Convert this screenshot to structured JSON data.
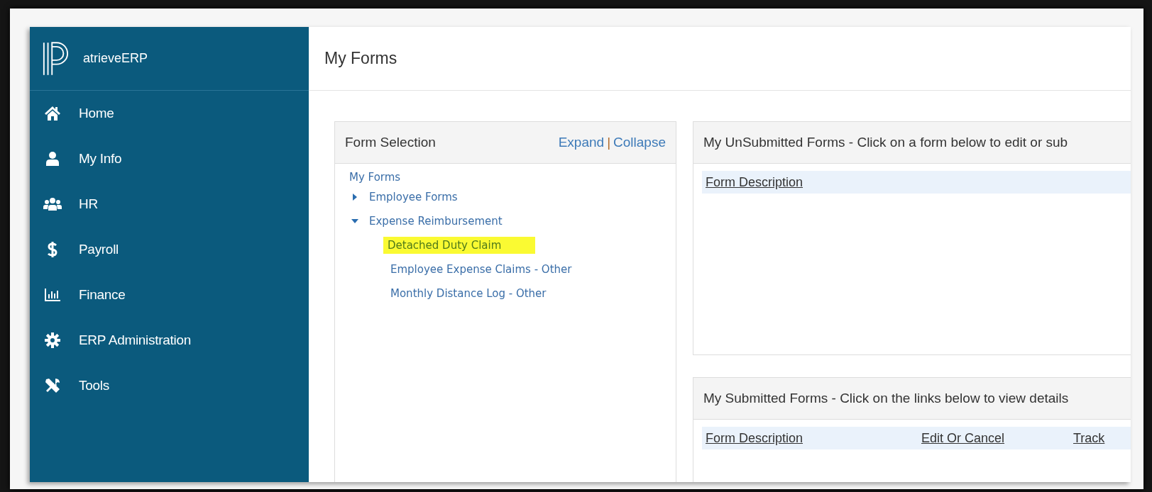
{
  "app": {
    "name": "atrieveERP"
  },
  "sidebar": {
    "items": [
      {
        "label": "Home"
      },
      {
        "label": "My Info"
      },
      {
        "label": "HR"
      },
      {
        "label": "Payroll"
      },
      {
        "label": "Finance"
      },
      {
        "label": "ERP Administration"
      },
      {
        "label": "Tools"
      }
    ]
  },
  "page": {
    "title": "My Forms"
  },
  "form_selection": {
    "title": "Form Selection",
    "expand_link": "Expand",
    "separator": "|",
    "collapse_link": "Collapse",
    "tree": {
      "label": "My Forms",
      "children": [
        {
          "label": "Employee Forms",
          "expanded": false
        },
        {
          "label": "Expense Reimbursement",
          "expanded": true,
          "children": [
            {
              "label": "Detached Duty Claim",
              "selected": true
            },
            {
              "label": "Employee Expense Claims - Other",
              "selected": false
            },
            {
              "label": "Monthly Distance Log - Other",
              "selected": false
            }
          ]
        }
      ]
    }
  },
  "unsubmitted": {
    "title": "My UnSubmitted Forms - Click on a form below to edit or sub",
    "columns": [
      "Form Description"
    ]
  },
  "submitted": {
    "title": "My Submitted Forms - Click on the links below to view details",
    "columns": [
      "Form Description",
      "Edit Or Cancel",
      "Track"
    ]
  }
}
